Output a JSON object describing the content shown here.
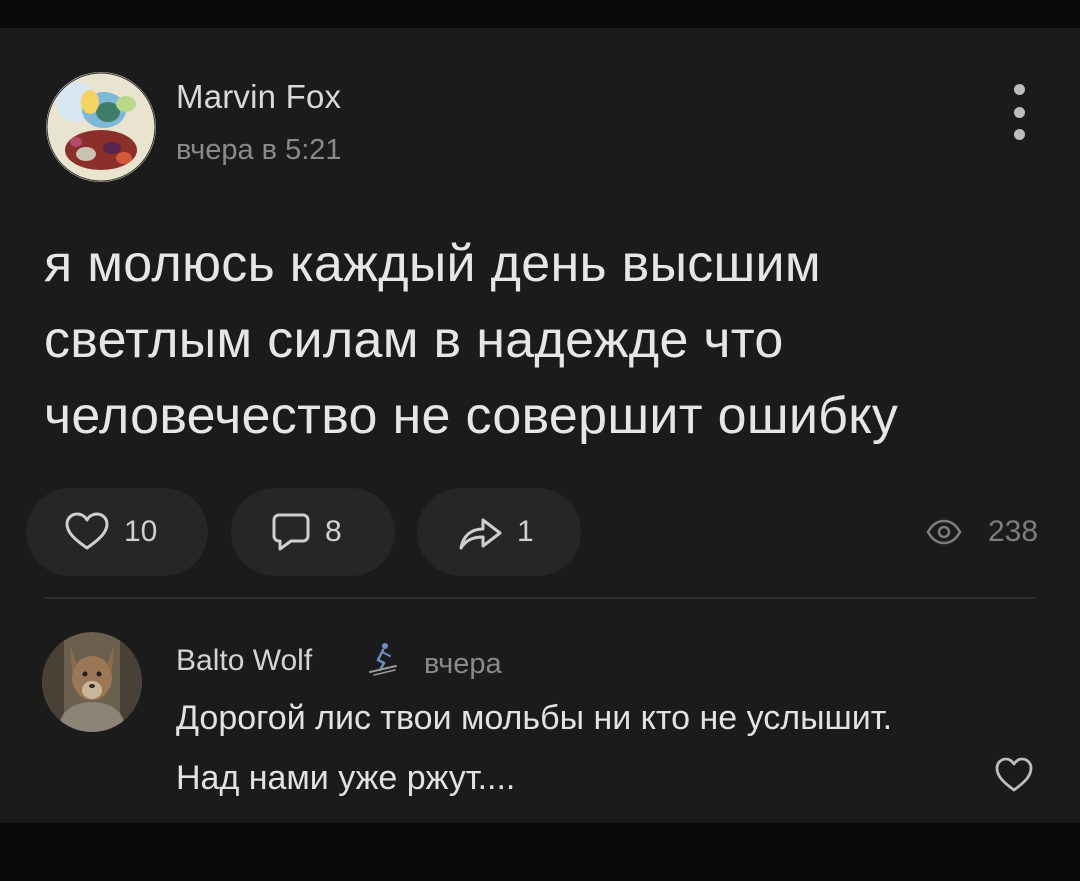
{
  "post": {
    "author": "Marvin Fox",
    "time": "вчера в 5:21",
    "text": "я молюсь каждый день высшим светлым силам в надежде что человечество не совершит ошибку",
    "actions": {
      "likes": "10",
      "comments": "8",
      "shares": "1",
      "views": "238"
    },
    "icons": {
      "avatar": "avatar-image",
      "menu": "more-vertical-icon",
      "like": "heart-outline-icon",
      "comment": "comment-bubble-icon",
      "share": "share-arrow-icon",
      "views": "eye-icon"
    }
  },
  "comment": {
    "author": "Balto Wolf",
    "badge_icon": "skier-icon",
    "time": "вчера",
    "text": "Дорогой лис твои мольбы ни кто не услышит. Над нами уже ржут....",
    "like_icon": "heart-outline-icon"
  },
  "colors": {
    "background": "#0a0a0a",
    "card": "#1b1b1b",
    "pill": "#262626",
    "text_primary": "#e6e6e6",
    "text_secondary": "#8a8a8a"
  }
}
